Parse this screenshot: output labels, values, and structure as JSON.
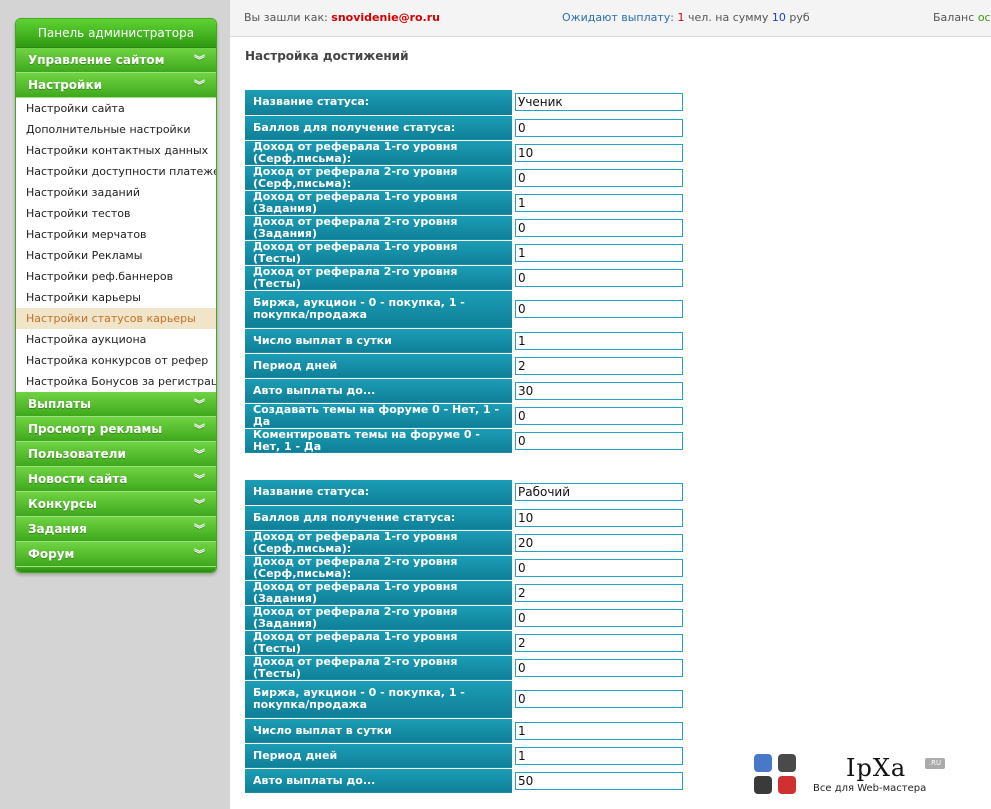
{
  "sidebar": {
    "title": "Панель администратора",
    "top_menus": [
      {
        "label": "Управление сайтом"
      }
    ],
    "settings_menu": {
      "label": "Настройки",
      "items": [
        {
          "label": "Настройки сайта"
        },
        {
          "label": "Дополнительные настройки"
        },
        {
          "label": "Настройки контактных данных"
        },
        {
          "label": "Настройки доступности платежек"
        },
        {
          "label": "Настройки заданий"
        },
        {
          "label": "Настройки тестов"
        },
        {
          "label": "Настройки мерчатов"
        },
        {
          "label": "Настройки Рекламы"
        },
        {
          "label": "Настройки реф.баннеров"
        },
        {
          "label": "Настройки карьеры"
        },
        {
          "label": "Настройки статусов карьеры"
        },
        {
          "label": "Настройка аукциона"
        },
        {
          "label": "Настройка конкурсов от рефер"
        },
        {
          "label": "Настройка Бонусов за регистраци"
        }
      ],
      "active_index": 10
    },
    "bottom_menus": [
      {
        "label": "Выплаты"
      },
      {
        "label": "Просмотр рекламы"
      },
      {
        "label": "Пользователи"
      },
      {
        "label": "Новости сайта"
      },
      {
        "label": "Конкурсы"
      },
      {
        "label": "Задания"
      },
      {
        "label": "Форум"
      }
    ],
    "chevron": "︾"
  },
  "topbar": {
    "user_prefix": "Вы зашли как:",
    "user_email": "snovidenie@ro.ru",
    "wait_prefix": "Ожидают выплату:",
    "wait_count": "1",
    "wait_mid": "чел. на сумму",
    "wait_sum": "10",
    "wait_currency": "руб",
    "balance_prefix": "Баланс",
    "balance_value": "осно"
  },
  "main": {
    "title": "Настройка достижений",
    "statuses": [
      {
        "rows": [
          {
            "label": "Название статуса:",
            "value": "Ученик"
          },
          {
            "label": "Баллов для получение статуса:",
            "value": "0"
          },
          {
            "label": "Доход от реферала 1-го уровня (Серф,письма):",
            "value": "10"
          },
          {
            "label": "Доход от реферала 2-го уровня (Серф,письма):",
            "value": "0"
          },
          {
            "label": "Доход от реферала 1-го уровня (Задания)",
            "value": "1"
          },
          {
            "label": "Доход от реферала 2-го уровня (Задания)",
            "value": "0"
          },
          {
            "label": "Доход от реферала 1-го уровня (Тесты)",
            "value": "1"
          },
          {
            "label": "Доход от реферала 2-го уровня (Тесты)",
            "value": "0"
          },
          {
            "label": "Биржа, аукцион - 0 - покупка, 1 - покупка/продажа",
            "value": "0"
          },
          {
            "label": "Число выплат в сутки",
            "value": "1"
          },
          {
            "label": "Период дней",
            "value": "2"
          },
          {
            "label": "Авто выплаты до...",
            "value": "30"
          },
          {
            "label": "Создавать темы на форуме 0 - Нет, 1 - Да",
            "value": "0"
          },
          {
            "label": "Коментировать темы на форуме 0 - Нет, 1 - Да",
            "value": "0"
          }
        ]
      },
      {
        "rows": [
          {
            "label": "Название статуса:",
            "value": "Рабочий"
          },
          {
            "label": "Баллов для получение статуса:",
            "value": "10"
          },
          {
            "label": "Доход от реферала 1-го уровня (Серф,письма):",
            "value": "20"
          },
          {
            "label": "Доход от реферала 2-го уровня (Серф,письма):",
            "value": "0"
          },
          {
            "label": "Доход от реферала 1-го уровня (Задания)",
            "value": "2"
          },
          {
            "label": "Доход от реферала 2-го уровня (Задания)",
            "value": "0"
          },
          {
            "label": "Доход от реферала 1-го уровня (Тесты)",
            "value": "2"
          },
          {
            "label": "Доход от реферала 2-го уровня (Тесты)",
            "value": "0"
          },
          {
            "label": "Биржа, аукцион - 0 - покупка, 1 - покупка/продажа",
            "value": "0"
          },
          {
            "label": "Число выплат в сутки",
            "value": "1"
          },
          {
            "label": "Период дней",
            "value": "1"
          },
          {
            "label": "Авто выплаты до...",
            "value": "50"
          }
        ]
      }
    ]
  },
  "watermark": {
    "logo_text": "IpXa",
    "badge": ".RU",
    "subtitle": "Все для Web-мастера",
    "colors": [
      "#4a78c8",
      "#4a4a4a",
      "#3a3a3a",
      "#d03030"
    ]
  }
}
